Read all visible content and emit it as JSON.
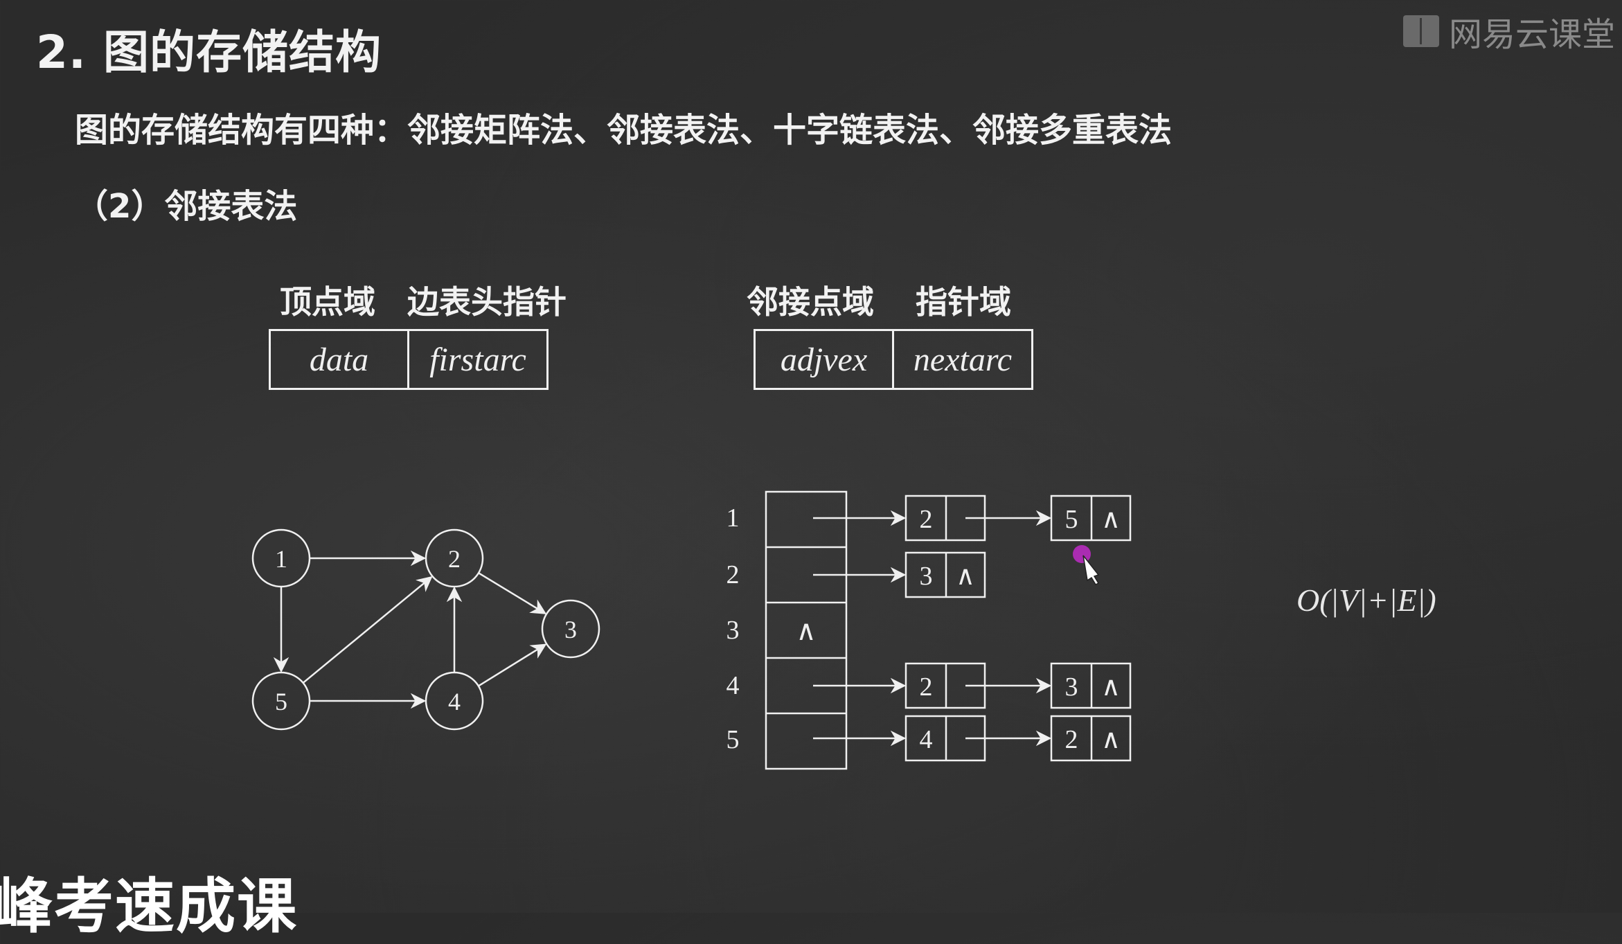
{
  "title": "2. 图的存储结构",
  "logo": {
    "text": "网易云课堂",
    "icon": "book-icon"
  },
  "subtitle": "图的存储结构有四种：邻接矩阵法、邻接表法、十字链表法、邻接多重表法",
  "section": "（2）邻接表法",
  "vertex_node": {
    "label_left": "顶点域",
    "label_right": "边表头指针",
    "fields": [
      "data",
      "firstarc"
    ]
  },
  "arc_node": {
    "label_left": "邻接点域",
    "label_right": "指针域",
    "fields": [
      "adjvex",
      "nextarc"
    ]
  },
  "graph": {
    "nodes": [
      "1",
      "2",
      "3",
      "4",
      "5"
    ],
    "edges": [
      [
        "1",
        "2"
      ],
      [
        "1",
        "5"
      ],
      [
        "5",
        "2"
      ],
      [
        "5",
        "4"
      ],
      [
        "4",
        "2"
      ],
      [
        "2",
        "3"
      ],
      [
        "4",
        "3"
      ]
    ]
  },
  "adjacency_list": {
    "null_symbol": "∧",
    "rows": [
      {
        "index": "1",
        "list": [
          "2",
          "5"
        ],
        "head_null": false
      },
      {
        "index": "2",
        "list": [
          "3"
        ],
        "head_null": false
      },
      {
        "index": "3",
        "list": [],
        "head_null": true
      },
      {
        "index": "4",
        "list": [
          "2",
          "3"
        ],
        "head_null": false
      },
      {
        "index": "5",
        "list": [
          "4",
          "2"
        ],
        "head_null": false
      }
    ]
  },
  "complexity": "O(|V|+|E|)",
  "watermark": "峰考速成课"
}
